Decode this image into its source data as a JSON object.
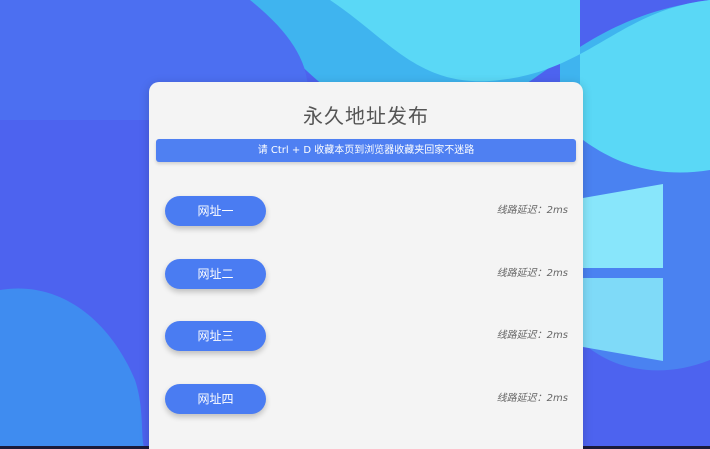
{
  "page": {
    "title": "永久地址发布",
    "notice": "请 Ctrl + D 收藏本页到浏览器收藏夹回家不迷路"
  },
  "links": [
    {
      "label": "网址一",
      "latency": "线路延迟：2ms"
    },
    {
      "label": "网址二",
      "latency": "线路延迟：2ms"
    },
    {
      "label": "网址三",
      "latency": "线路延迟：2ms"
    },
    {
      "label": "网址四",
      "latency": "线路延迟：2ms"
    }
  ],
  "colors": {
    "background": "#4f6ff0",
    "card": "#f4f4f4",
    "accent": "#4f80f2"
  }
}
